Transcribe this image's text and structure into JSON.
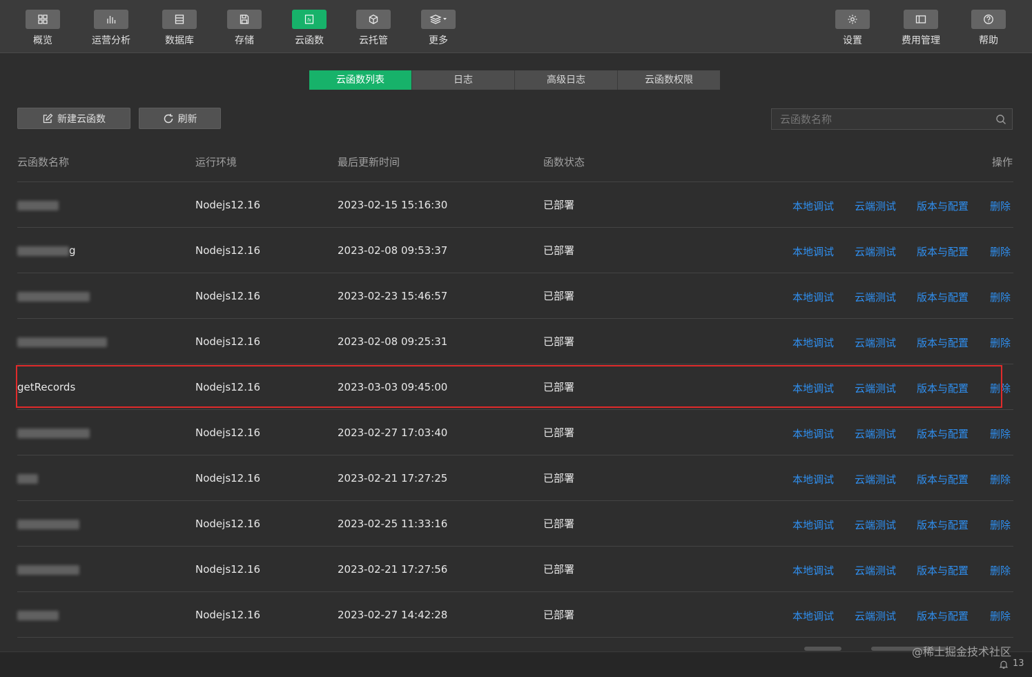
{
  "toolbar": {
    "left": [
      {
        "label": "概览",
        "icon": "grid-icon"
      },
      {
        "label": "运营分析",
        "icon": "bar-chart-icon"
      },
      {
        "label": "数据库",
        "icon": "database-icon"
      },
      {
        "label": "存储",
        "icon": "storage-icon"
      },
      {
        "label": "云函数",
        "icon": "function-icon",
        "active": true
      },
      {
        "label": "云托管",
        "icon": "cube-icon"
      },
      {
        "label": "更多",
        "icon": "layers-dropdown-icon"
      }
    ],
    "right": [
      {
        "label": "设置",
        "icon": "gear-icon"
      },
      {
        "label": "费用管理",
        "icon": "billing-icon"
      },
      {
        "label": "帮助",
        "icon": "help-icon"
      }
    ]
  },
  "tabs": [
    {
      "label": "云函数列表",
      "active": true
    },
    {
      "label": "日志"
    },
    {
      "label": "高级日志"
    },
    {
      "label": "云函数权限"
    }
  ],
  "actions": {
    "new_label": "新建云函数",
    "refresh_label": "刷新"
  },
  "search": {
    "placeholder": "云函数名称",
    "value": ""
  },
  "table": {
    "headers": {
      "name": "云函数名称",
      "runtime": "运行环境",
      "updated": "最后更新时间",
      "status": "函数状态",
      "ops": "操作"
    },
    "op_labels": [
      "本地调试",
      "云端测试",
      "版本与配置",
      "删除"
    ],
    "rows": [
      {
        "name": "",
        "runtime": "Nodejs12.16",
        "updated": "2023-02-15 15:16:30",
        "status": "已部署"
      },
      {
        "name": "g",
        "runtime": "Nodejs12.16",
        "updated": "2023-02-08 09:53:37",
        "status": "已部署"
      },
      {
        "name": "",
        "runtime": "Nodejs12.16",
        "updated": "2023-02-23 15:46:57",
        "status": "已部署"
      },
      {
        "name": "",
        "runtime": "Nodejs12.16",
        "updated": "2023-02-08 09:25:31",
        "status": "已部署"
      },
      {
        "name": "getRecords",
        "runtime": "Nodejs12.16",
        "updated": "2023-03-03 09:45:00",
        "status": "已部署",
        "highlighted": true
      },
      {
        "name": "",
        "runtime": "Nodejs12.16",
        "updated": "2023-02-27 17:03:40",
        "status": "已部署"
      },
      {
        "name": "",
        "runtime": "Nodejs12.16",
        "updated": "2023-02-21 17:27:25",
        "status": "已部署"
      },
      {
        "name": "",
        "runtime": "Nodejs12.16",
        "updated": "2023-02-25 11:33:16",
        "status": "已部署"
      },
      {
        "name": "",
        "runtime": "Nodejs12.16",
        "updated": "2023-02-21 17:27:56",
        "status": "已部署"
      },
      {
        "name": "",
        "runtime": "Nodejs12.16",
        "updated": "2023-02-27 14:42:28",
        "status": "已部署"
      }
    ]
  },
  "footer": {
    "watermark": "@稀土掘金技术社区",
    "notifications": "13"
  },
  "colors": {
    "accent": "#17b26a",
    "link": "#2f8ff0",
    "highlight": "#e02b2b",
    "background": "#2e2e2e"
  }
}
